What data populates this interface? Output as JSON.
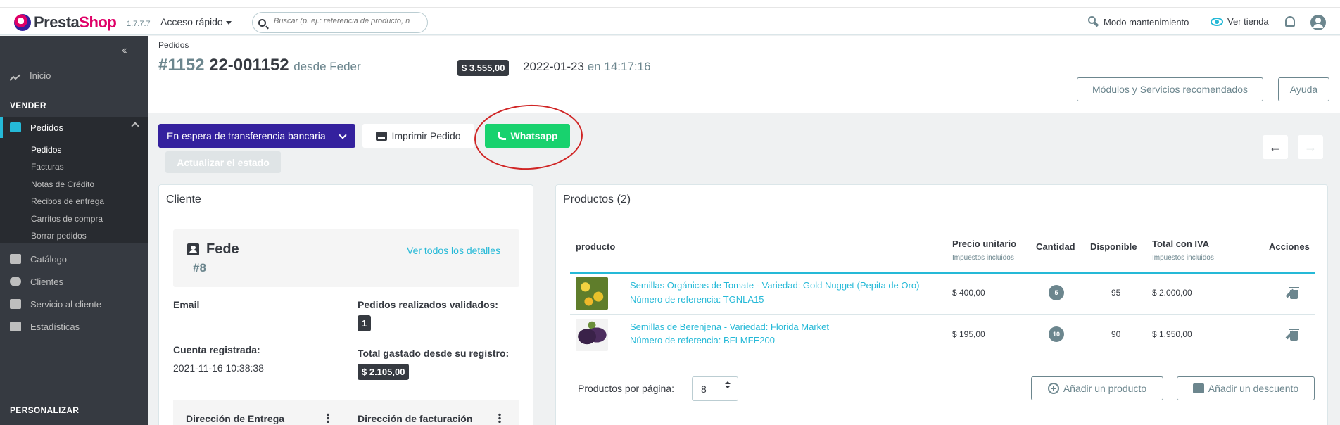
{
  "topbar": {
    "brand": "PrestaShop",
    "version": "1.7.7.7",
    "quick_access": "Acceso rápido",
    "search_placeholder": "Buscar (p. ej.: referencia de producto, n",
    "maintenance": "Modo mantenimiento",
    "view_store": "Ver tienda"
  },
  "sidebar": {
    "home": "Inicio",
    "section_sell": "VENDER",
    "orders": "Pedidos",
    "sub_items": [
      "Pedidos",
      "Facturas",
      "Notas de Crédito",
      "Recibos de entrega",
      "Carritos de compra",
      "Borrar pedidos"
    ],
    "catalog": "Catálogo",
    "customers": "Clientes",
    "customer_service": "Servicio al cliente",
    "stats": "Estadísticas",
    "section_customize": "PERSONALIZAR"
  },
  "header": {
    "breadcrumb": "Pedidos",
    "order_number": "#1152",
    "order_ref": "22-001152",
    "from_label": "desde Feder",
    "total": "$ 3.555,00",
    "date": "2022-01-23",
    "date_sep": "en",
    "time": "14:17:16",
    "modules_button": "Módulos y Servicios recomendados",
    "help_button": "Ayuda"
  },
  "actions": {
    "status": "En espera de transferencia bancaria",
    "print": "Imprimir Pedido",
    "whatsapp": "Whatsapp",
    "update_status": "Actualizar el estado",
    "accent_whatsapp": "#18d26e",
    "accent_status": "#34219e"
  },
  "customer": {
    "title": "Cliente",
    "name": "Fede",
    "id": "#8",
    "details_link": "Ver todos los detalles",
    "email_label": "Email",
    "registered_label": "Cuenta registrada:",
    "registered_value": "2021-11-16 10:38:38",
    "valid_orders_label": "Pedidos realizados validados:",
    "valid_orders_value": "1",
    "total_spent_label": "Total gastado desde su registro:",
    "total_spent_value": "$ 2.105,00",
    "shipping_address": "Dirección de Entrega",
    "billing_address": "Dirección de facturación"
  },
  "products": {
    "title": "Productos (2)",
    "columns": {
      "product": "producto",
      "unit_price": "Precio unitario",
      "unit_price_sub": "Impuestos incluidos",
      "quantity": "Cantidad",
      "available": "Disponible",
      "total": "Total con IVA",
      "total_sub": "Impuestos incluidos",
      "actions": "Acciones"
    },
    "rows": [
      {
        "name": "Semillas Orgánicas de Tomate - Variedad: Gold Nugget (Pepita de Oro)",
        "ref": "Número de referencia: TGNLA15",
        "price": "$ 400,00",
        "qty": "5",
        "available": "95",
        "total": "$ 2.000,00"
      },
      {
        "name": "Semillas de Berenjena - Variedad: Florida Market",
        "ref": "Número de referencia: BFLMFE200",
        "price": "$ 195,00",
        "qty": "10",
        "available": "90",
        "total": "$ 1.950,00"
      }
    ],
    "per_page_label": "Productos por página:",
    "per_page_value": "8",
    "add_product": "Añadir un producto",
    "add_discount": "Añadir un descuento"
  }
}
